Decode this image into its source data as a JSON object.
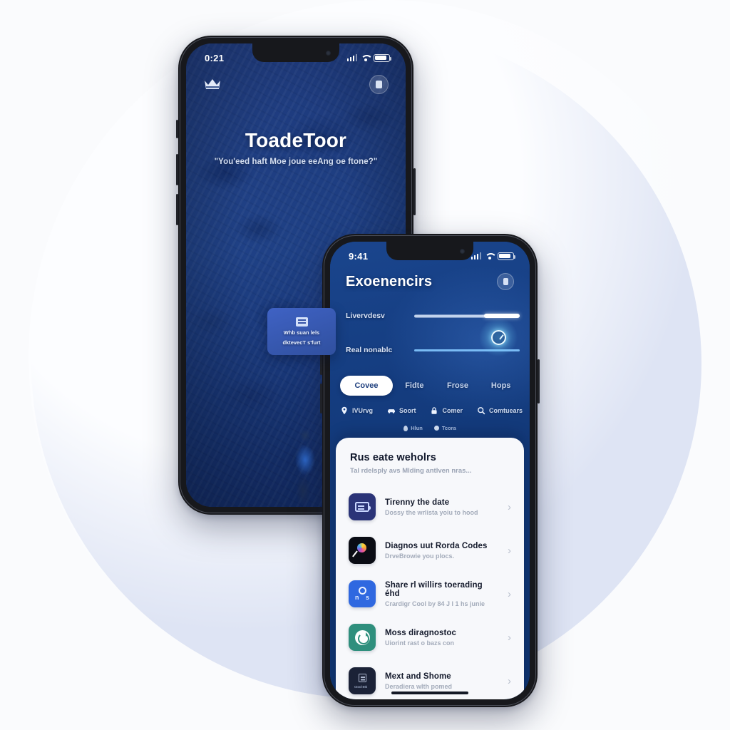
{
  "background": {
    "page_color": "#fafbfd",
    "circle_color": "#dee4f4"
  },
  "phone_one": {
    "status_bar": {
      "time": "0:21",
      "signal_icon": "cellular-bars-icon",
      "wifi_icon": "wifi-icon",
      "battery_icon": "battery-icon"
    },
    "top_bar": {
      "menu_icon": "crown-icon",
      "badge_icon": "profile-badge-icon"
    },
    "hero": {
      "title": "ToadeToor",
      "subtitle": "\"You'eed haft Moe joue eeAng oe ftone?\""
    },
    "floating_card": {
      "icon": "card-image-icon",
      "line_one": "Whb suan lels",
      "line_two": "dktevecT s'furt"
    }
  },
  "phone_two": {
    "status_bar": {
      "time": "9:41",
      "signal_icon": "cellular-bars-icon",
      "wifi_icon": "wifi-icon",
      "battery_icon": "battery-icon"
    },
    "header": {
      "title": "Exoenencirs",
      "badge_icon": "profile-badge-icon"
    },
    "sliders": [
      {
        "label": "Livervdesv",
        "fill_percent": 72,
        "accent": "#ffffff"
      },
      {
        "label": "Real nonablc",
        "fill_percent": 100,
        "accent": "#84c8ff"
      }
    ],
    "gauge_icon": "speedometer-gauge-icon",
    "segments": [
      {
        "label": "Covee",
        "active": true
      },
      {
        "label": "Fidte",
        "active": false
      },
      {
        "label": "Frose",
        "active": false
      },
      {
        "label": "Hops",
        "active": false
      }
    ],
    "icon_row": [
      {
        "icon": "location-pin-icon",
        "label": "IVUrvg"
      },
      {
        "icon": "car-icon",
        "label": "Soort"
      },
      {
        "icon": "lock-icon",
        "label": "Comer"
      },
      {
        "icon": "search-icon",
        "label": "Comtuears"
      }
    ],
    "dot_row": [
      {
        "icon": "map-pin-icon",
        "label": "Hlun"
      },
      {
        "icon": "dot-icon",
        "label": "Tcora"
      }
    ],
    "sheet": {
      "title": "Rus eate weholrs",
      "subtitle": "Tal rdelsply avs Mlding antlven nras...",
      "rows": [
        {
          "tile_color": "#2b3478",
          "icon": "car-battery-icon",
          "title": "Tirenny the date",
          "subtitle": "Dossy the wrlista yoiu to  hood",
          "chevron": "›"
        },
        {
          "tile_color": "#0a0c14",
          "icon": "color-lollipop-icon",
          "title": "Diagnos uut Rorda Codes",
          "subtitle": "DrveBrowie you plocs.",
          "chevron": "›"
        },
        {
          "tile_color": "#2f68e0",
          "icon": "share-network-icon",
          "title": "Share rl willirs toerading éhd",
          "subtitle": "Crardigr Cool by 84 J l 1 hs junie",
          "chevron": "›"
        },
        {
          "tile_color": "#2f8f7d",
          "icon": "refresh-diagnostic-icon",
          "title": "Moss diragnostoc",
          "subtitle": "Uiorint rast o bazs con",
          "chevron": "›"
        },
        {
          "tile_color": "#1b2237",
          "icon": "document-card-icon",
          "icon_caption": "Ctool Etk",
          "title": "Mext and Shome",
          "subtitle": "Deradiera wlth pomed",
          "chevron": "›"
        }
      ]
    }
  }
}
